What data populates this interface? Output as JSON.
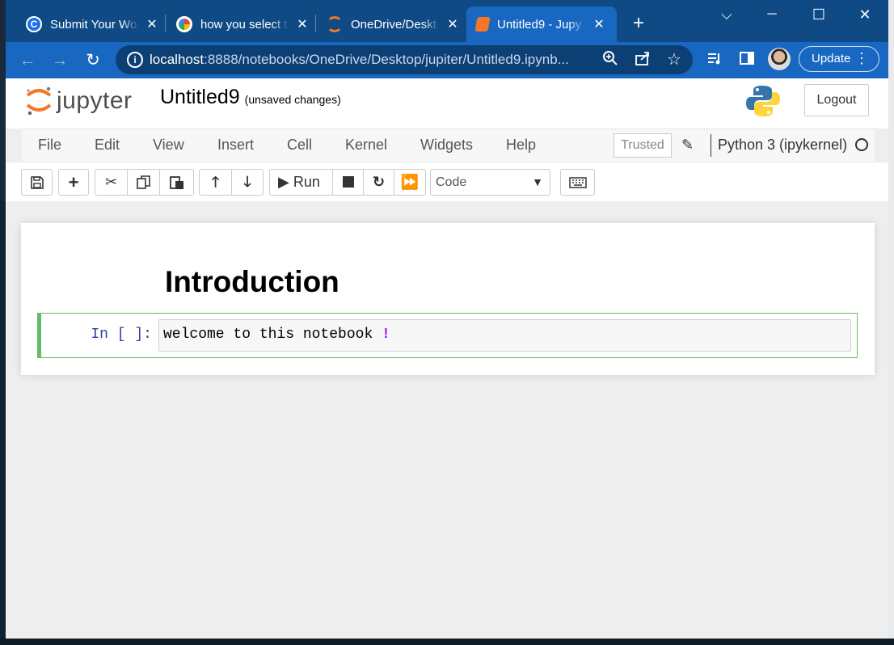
{
  "browser": {
    "tabs": [
      {
        "label": "Submit Your Wo",
        "icon": "c-logo-icon",
        "color": "#ffffff"
      },
      {
        "label": "how you select t",
        "icon": "google-icon",
        "color": "#ffffff"
      },
      {
        "label": "OneDrive/Deskt",
        "icon": "jupyter-icon",
        "color": "#f37726"
      },
      {
        "label": "Untitled9 - Jupy",
        "icon": "notebook-icon",
        "color": "#f37726"
      }
    ],
    "close_glyph": "✕",
    "new_tab_glyph": "+",
    "window": {
      "minimize": "─",
      "maximize": "☐",
      "close": "✕",
      "chevron": "⌵"
    },
    "url_host": "localhost",
    "url_rest": ":8888/notebooks/OneDrive/Desktop/jupiter/Untitled9.ipynb...",
    "update_label": "Update",
    "nav": {
      "back": "←",
      "forward": "→",
      "reload": "↻"
    }
  },
  "jupyter": {
    "logo_text": "jupyter",
    "notebook_name": "Untitled9",
    "save_status": "(unsaved changes)",
    "logout_label": "Logout",
    "menus": [
      "File",
      "Edit",
      "View",
      "Insert",
      "Cell",
      "Kernel",
      "Widgets",
      "Help"
    ],
    "trusted_label": "Trusted",
    "kernel_name": "Python 3 (ipykernel)",
    "run_label": "Run",
    "cell_type": "Code",
    "toolbar_icons": {
      "save": "save-icon",
      "insert": "plus-icon",
      "cut": "scissors-icon",
      "copy": "copy-icon",
      "paste": "paste-icon",
      "up": "arrow-up-icon",
      "down": "arrow-down-icon",
      "run": "play-icon",
      "stop": "stop-icon",
      "restart": "restart-icon",
      "restart_run": "fast-forward-icon",
      "keyboard": "keyboard-icon"
    }
  },
  "notebook": {
    "markdown_heading": "Introduction",
    "prompt": "In [ ]:",
    "code_text": "welcome to this notebook ",
    "code_operator": "!"
  },
  "colors": {
    "tabbar": "#0f4a85",
    "active_tab": "#1867c0",
    "jupyter_orange": "#f37726",
    "cell_border": "#66bb6a",
    "prompt": "#303f9f"
  }
}
